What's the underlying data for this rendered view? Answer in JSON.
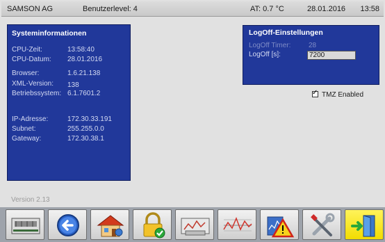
{
  "header": {
    "company": "SAMSON AG",
    "user_level": "Benutzerlevel:  4",
    "temperature": "AT:  0.7 °C",
    "date": "28.01.2016",
    "time": "13:58"
  },
  "system_info": {
    "title": "Systeminformationen",
    "cpu_time_label": "CPU-Zeit:",
    "cpu_time": "13:58:40",
    "cpu_date_label": "CPU-Datum:",
    "cpu_date": "28.01.2016",
    "browser_label": "Browser:",
    "browser": "1.6.21.138",
    "xml_label": "XML-Version:",
    "xml": "138",
    "os_label": "Betriebssystem:",
    "os": "6.1.7601.2",
    "ip_label": "IP-Adresse:",
    "ip": "172.30.33.191",
    "subnet_label": "Subnet:",
    "subnet": "255.255.0.0",
    "gateway_label": "Gateway:",
    "gateway": "172.30.38.1"
  },
  "logoff": {
    "title": "LogOff-Einstellungen",
    "timer_label": "LogOff Timer:",
    "timer_value": "28",
    "seconds_label": "LogOff [s]:",
    "seconds_value": "7200"
  },
  "tmz": {
    "label": "TMZ Enabled",
    "checked": true
  },
  "version": "Version 2.13",
  "toolbar": {
    "buttons": [
      {
        "icon": "controller-device-icon"
      },
      {
        "icon": "back-arrow-icon"
      },
      {
        "icon": "home-icon"
      },
      {
        "icon": "lock-check-icon"
      },
      {
        "icon": "trend-monitor-icon"
      },
      {
        "icon": "trend-chart-icon"
      },
      {
        "icon": "alarm-warning-icon"
      },
      {
        "icon": "tools-icon"
      },
      {
        "icon": "logout-door-icon",
        "active": true
      }
    ]
  },
  "colors": {
    "panel_blue": "#21389a",
    "active_button": "#f5e400"
  }
}
